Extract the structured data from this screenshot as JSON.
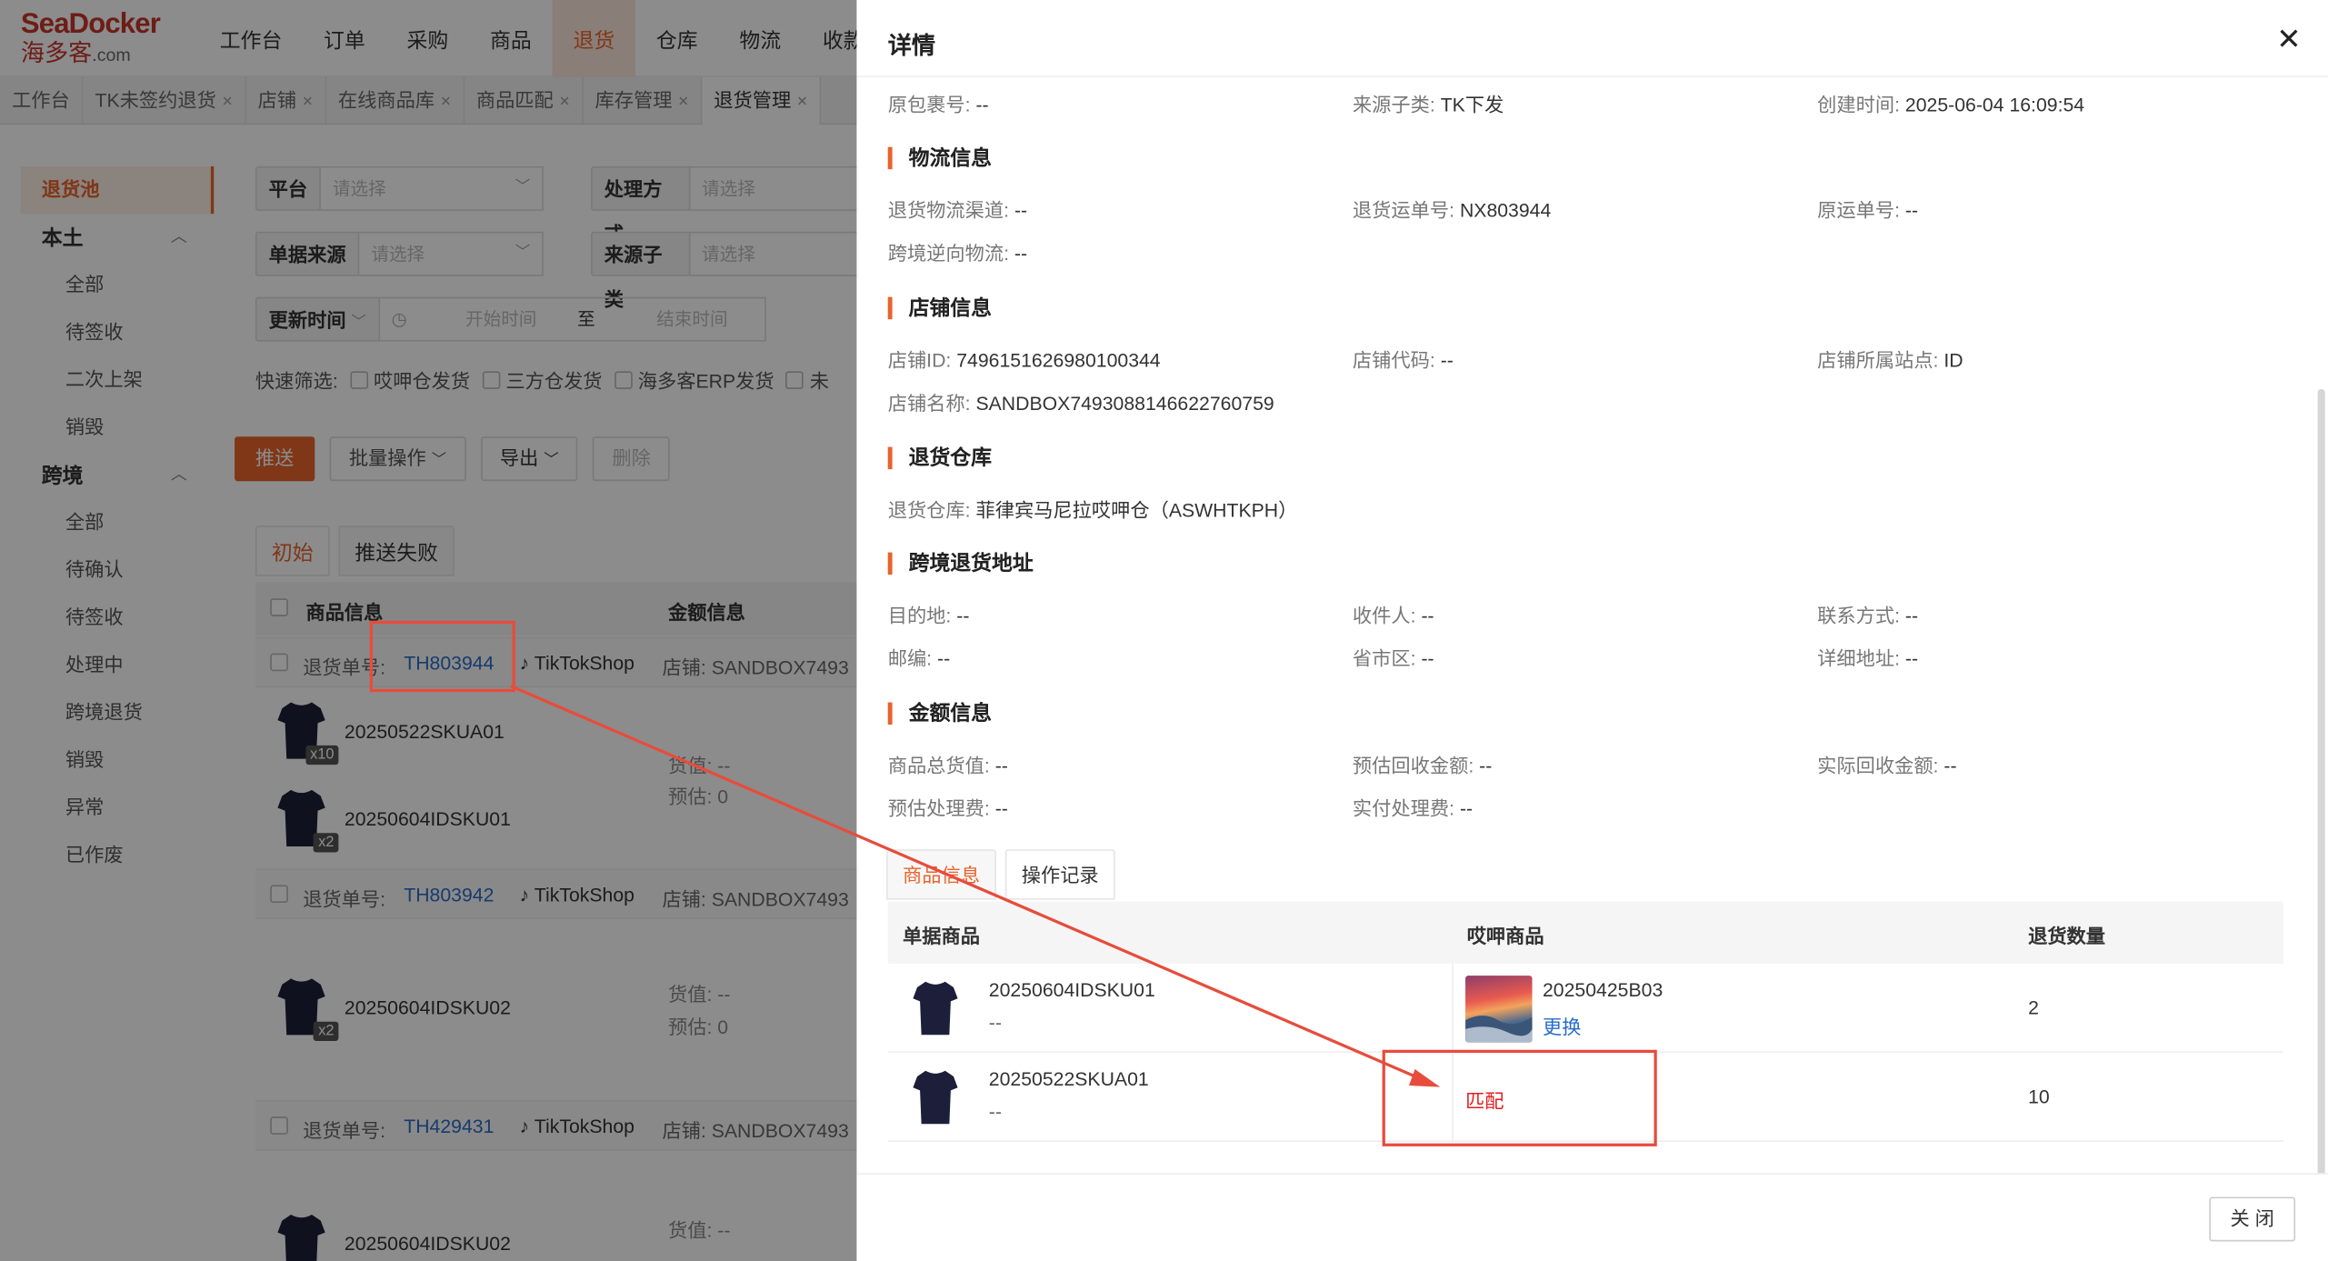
{
  "logo": {
    "brand": "SeaDocker",
    "brand_cn": "海多客",
    "domain": ".com"
  },
  "nav": [
    "工作台",
    "订单",
    "采购",
    "商品",
    "退货",
    "仓库",
    "物流",
    "收款"
  ],
  "nav_active": "退货",
  "tabs": [
    {
      "label": "工作台",
      "closable": false
    },
    {
      "label": "TK未签约退货",
      "closable": true
    },
    {
      "label": "店铺",
      "closable": true
    },
    {
      "label": "在线商品库",
      "closable": true
    },
    {
      "label": "商品匹配",
      "closable": true
    },
    {
      "label": "库存管理",
      "closable": true
    },
    {
      "label": "退货管理",
      "closable": true
    }
  ],
  "sidebar": {
    "pool": "退货池",
    "local_group": "本土",
    "local_items": [
      "全部",
      "待签收",
      "二次上架",
      "销毁"
    ],
    "cross_group": "跨境",
    "cross_items": [
      "全部",
      "待确认",
      "待签收",
      "处理中",
      "跨境退货",
      "销毁",
      "异常",
      "已作废"
    ]
  },
  "filters": {
    "platform": "平台",
    "platform_ph": "请选择",
    "handle": "处理方式",
    "handle_ph": "请选择",
    "source": "单据来源",
    "source_ph": "请选择",
    "subsource": "来源子类",
    "subsource_ph": "请选择",
    "time": "更新时间",
    "start_ph": "开始时间",
    "to": "至",
    "end_ph": "结束时间",
    "quick_label": "快速筛选:",
    "quick": [
      "哎呷仓发货",
      "三方仓发货",
      "海多客ERP发货",
      "未"
    ]
  },
  "actions": {
    "push": "推送",
    "batch": "批量操作",
    "export": "导出",
    "delete": "删除"
  },
  "list_tabs": [
    "初始",
    "推送失败"
  ],
  "list_headers": {
    "product": "商品信息",
    "amount": "金额信息"
  },
  "orders": [
    {
      "label": "退货单号:",
      "number": "TH803944",
      "platform": "TikTokShop",
      "shop": "店铺: SANDBOX7493",
      "items": [
        {
          "sku": "20250522SKUA01",
          "badge": "x10"
        },
        {
          "sku": "20250604IDSKU01",
          "badge": "x2"
        }
      ],
      "goods_value": "货值: --",
      "est": "预估: 0"
    },
    {
      "label": "退货单号:",
      "number": "TH803942",
      "platform": "TikTokShop",
      "shop": "店铺: SANDBOX7493",
      "items": [
        {
          "sku": "20250604IDSKU02",
          "badge": "x2"
        }
      ],
      "goods_value": "货值: --",
      "est": "预估: 0"
    },
    {
      "label": "退货单号:",
      "number": "TH429431",
      "platform": "TikTokShop",
      "shop": "店铺: SANDBOX7493",
      "items": [
        {
          "sku": "20250604IDSKU02",
          "badge": ""
        }
      ],
      "goods_value": "货值: --",
      "est": ""
    }
  ],
  "drawer": {
    "title": "详情",
    "close_label": "关 闭",
    "top_row": [
      {
        "k": "原包裹号:",
        "v": "--"
      },
      {
        "k": "来源子类:",
        "v": "TK下发"
      },
      {
        "k": "创建时间:",
        "v": "2025-06-04 16:09:54"
      }
    ],
    "logistics": {
      "title": "物流信息",
      "fields": [
        {
          "k": "退货物流渠道:",
          "v": "--"
        },
        {
          "k": "退货运单号:",
          "v": "NX803944"
        },
        {
          "k": "原运单号:",
          "v": "--"
        },
        {
          "k": "跨境逆向物流:",
          "v": "--"
        }
      ]
    },
    "store": {
      "title": "店铺信息",
      "fields": [
        {
          "k": "店铺ID:",
          "v": "7496151626980100344"
        },
        {
          "k": "店铺代码:",
          "v": "--"
        },
        {
          "k": "店铺所属站点:",
          "v": "ID"
        },
        {
          "k": "店铺名称:",
          "v": "SANDBOX7493088146622760759"
        }
      ]
    },
    "warehouse": {
      "title": "退货仓库",
      "fields": [
        {
          "k": "退货仓库:",
          "v": "菲律宾马尼拉哎呷仓（ASWHTKPH）"
        }
      ]
    },
    "address": {
      "title": "跨境退货地址",
      "fields": [
        {
          "k": "目的地:",
          "v": "--"
        },
        {
          "k": "收件人:",
          "v": "--"
        },
        {
          "k": "联系方式:",
          "v": "--"
        },
        {
          "k": "邮编:",
          "v": "--"
        },
        {
          "k": "省市区:",
          "v": "--"
        },
        {
          "k": "详细地址:",
          "v": "--"
        }
      ]
    },
    "amount": {
      "title": "金额信息",
      "fields": [
        {
          "k": "商品总货值:",
          "v": "--"
        },
        {
          "k": "预估回收金额:",
          "v": "--"
        },
        {
          "k": "实际回收金额:",
          "v": "--"
        },
        {
          "k": "预估处理费:",
          "v": "--"
        },
        {
          "k": "实付处理费:",
          "v": "--"
        }
      ]
    },
    "inner_tabs": [
      "商品信息",
      "操作记录"
    ],
    "table": {
      "headers": [
        "单据商品",
        "哎呷商品",
        "退货数量"
      ],
      "rows": [
        {
          "sku": "20250604IDSKU01",
          "sub": "--",
          "matched_sku": "20250425B03",
          "change": "更换",
          "match": "",
          "qty": "2"
        },
        {
          "sku": "20250522SKUA01",
          "sub": "--",
          "matched_sku": "",
          "change": "",
          "match": "匹配",
          "qty": "10"
        }
      ]
    }
  },
  "colors": {
    "accent": "#e8642c",
    "link": "#2a6cc7",
    "annotation": "#e74c3c",
    "match": "#e02020"
  }
}
